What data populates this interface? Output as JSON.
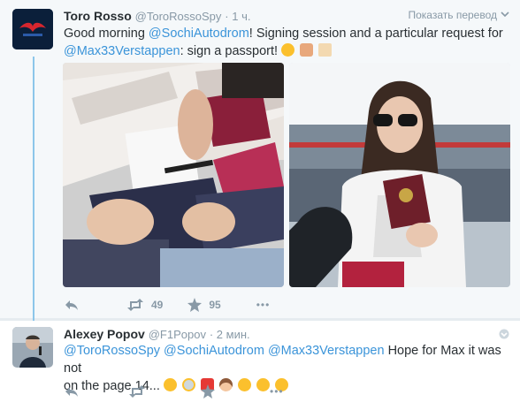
{
  "tweet1": {
    "name": "Toro Rosso",
    "handle": "@ToroRossoSpy",
    "time": "· 1 ч.",
    "translate": "Показать перевод",
    "text": {
      "p1": "Good morning ",
      "m1": "@SochiAutodrom",
      "p2": "! Signing session and a particular request for",
      "m2": "@Max33Verstappen",
      "p3": ": sign a passport! "
    },
    "retweets": "49",
    "likes": "95",
    "more": "•••"
  },
  "tweet2": {
    "name": "Alexey Popov",
    "handle": "@F1Popov",
    "time": "· 2 мин.",
    "text": {
      "m1": "@ToroRossoSpy",
      "m2": "@SochiAutodrom",
      "m3": "@Max33Verstappen",
      "p1": " Hope for Max it was not",
      "p2": "on the page 14... "
    },
    "more": "•••"
  },
  "colors": {
    "link": "#3b94d9",
    "meta": "#8899a6",
    "thread": "#8dc6ea",
    "like_active": "#8899a6"
  },
  "icons": [
    "reply-icon",
    "retweet-icon",
    "like-icon",
    "more-icon",
    "caret-down-icon"
  ]
}
